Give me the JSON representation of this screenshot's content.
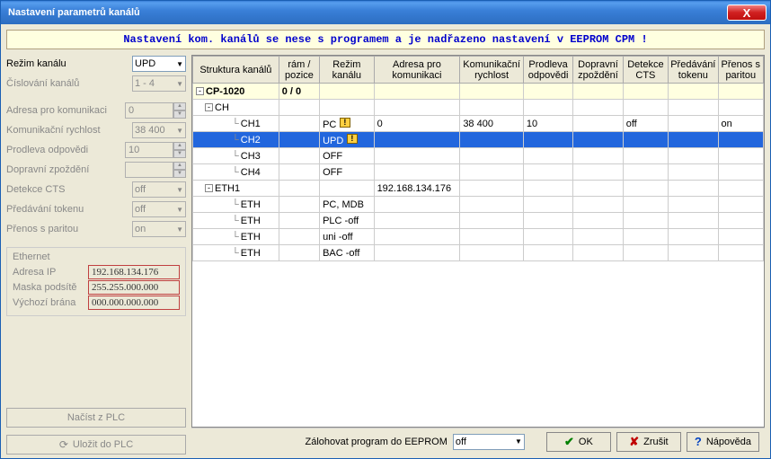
{
  "window": {
    "title": "Nastavení parametrů kanálů"
  },
  "banner": "Nastavení kom. kanálů se nese s programem a je nadřazeno nastavení v EEPROM CPM !",
  "left": {
    "mode_label": "Režim kanálu",
    "mode_value": "UPD",
    "numbering_label": "Číslování kanálů",
    "numbering_value": "1 - 4",
    "addr_label": "Adresa pro komunikaci",
    "addr_value": "0",
    "speed_label": "Komunikační rychlost",
    "speed_value": "38 400",
    "resp_label": "Prodleva odpovědi",
    "resp_value": "10",
    "delay_label": "Dopravní zpoždění",
    "delay_value": "",
    "cts_label": "Detekce CTS",
    "cts_value": "off",
    "token_label": "Předávání tokenu",
    "token_value": "off",
    "parity_label": "Přenos s paritou",
    "parity_value": "on",
    "eth": {
      "header": "Ethernet",
      "ip_label": "Adresa IP",
      "ip_value": "192.168.134.176",
      "mask_label": "Maska podsítě",
      "mask_value": "255.255.000.000",
      "gw_label": "Výchozí brána",
      "gw_value": "000.000.000.000"
    },
    "load_btn": "Načíst z PLC",
    "save_btn": "Uložit do PLC"
  },
  "grid": {
    "headers": {
      "struct": "Struktura kanálů",
      "frame": "rám / pozice",
      "mode": "Režim kanálu",
      "addr": "Adresa pro komunikaci",
      "speed": "Komunikační rychlost",
      "resp": "Prodleva odpovědi",
      "delay": "Dopravní zpoždění",
      "cts": "Detekce CTS",
      "token": "Předávání tokenu",
      "parity": "Přenos s paritou"
    },
    "rows": [
      {
        "indent": 0,
        "pm": "-",
        "label": "CP-1020",
        "bold": true,
        "frame": "0 / 0",
        "cream": true
      },
      {
        "indent": 1,
        "pm": "-",
        "label": "CH"
      },
      {
        "indent": 3,
        "label": "CH1",
        "mode": "PC",
        "warn": true,
        "addr": "0",
        "speed": "38 400",
        "resp": "10",
        "cts": "off",
        "parity": "on"
      },
      {
        "indent": 3,
        "label": "CH2",
        "mode": "UPD",
        "warn": true,
        "selected": true
      },
      {
        "indent": 3,
        "label": "CH3",
        "mode": "OFF"
      },
      {
        "indent": 3,
        "label": "CH4",
        "mode": "OFF"
      },
      {
        "indent": 1,
        "pm": "-",
        "label": "ETH1",
        "addr": "192.168.134.176"
      },
      {
        "indent": 3,
        "label": "ETH",
        "mode": "PC, MDB"
      },
      {
        "indent": 3,
        "label": "ETH",
        "mode": "PLC -off"
      },
      {
        "indent": 3,
        "label": "ETH",
        "mode": "uni -off"
      },
      {
        "indent": 3,
        "label": "ETH",
        "mode": "BAC -off"
      }
    ]
  },
  "bottom": {
    "backup_label": "Zálohovat program do EEPROM",
    "backup_value": "off",
    "ok": "OK",
    "cancel": "Zrušit",
    "help": "Nápověda"
  }
}
